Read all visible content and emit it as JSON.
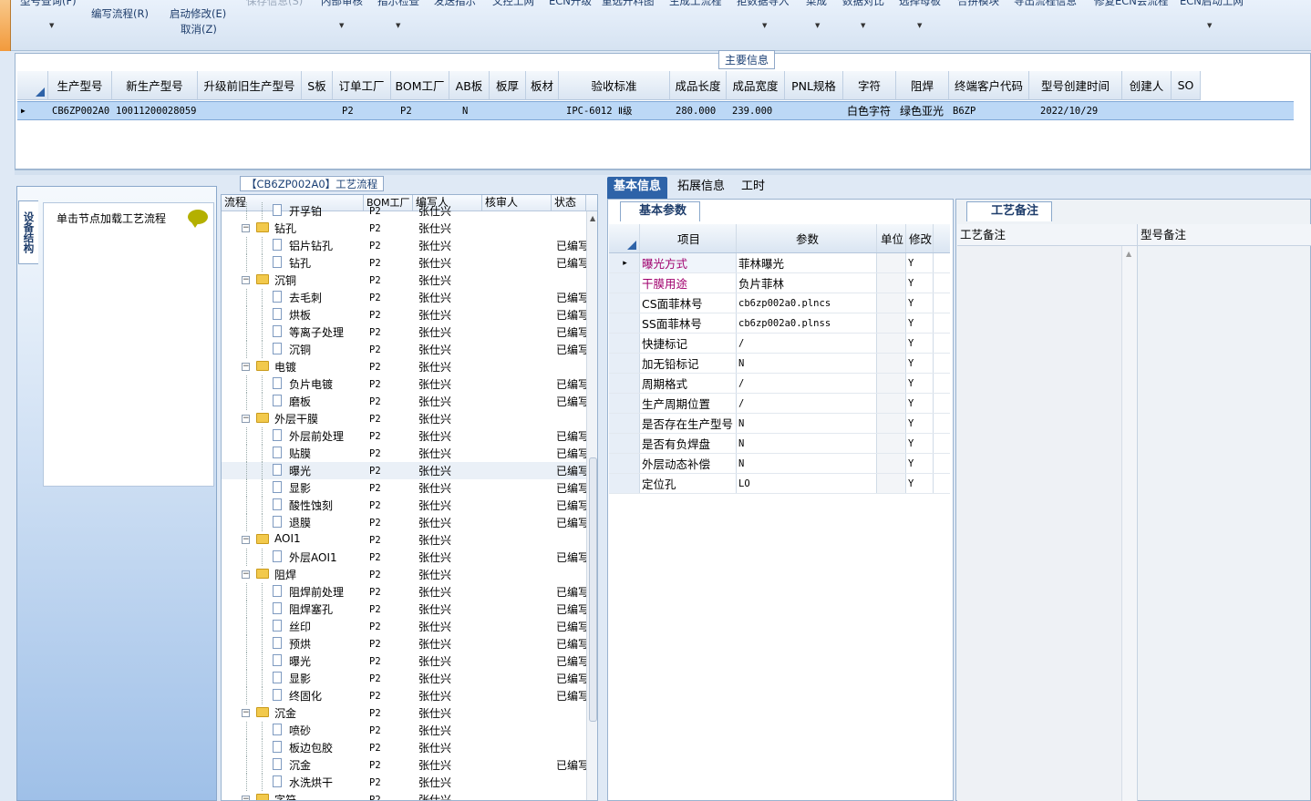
{
  "toolbar": {
    "items": [
      "型号查询(F)",
      "编写流程(R)",
      "启动修改(E)",
      "保存信息(S)",
      "内部审核",
      "指示检查",
      "发送指示",
      "文控上网",
      "ECN升级",
      "重选开料图",
      "生成工流程",
      "拒数据导入",
      "菜成",
      "数据对比",
      "选择母板",
      "合拼模块",
      "导出流程信息",
      "修复ECN会流程",
      "ECN启动上网"
    ],
    "sub_cancel": "取消(Z)"
  },
  "main_info": {
    "caption": "主要信息",
    "columns": [
      "生产型号",
      "新生产型号",
      "升级前旧生产型号",
      "S板",
      "订单工厂",
      "BOM工厂",
      "AB板",
      "板厚",
      "板材",
      "验收标准",
      "成品长度",
      "成品宽度",
      "PNL规格",
      "字符",
      "阻焊",
      "终端客户代码",
      "型号创建时间",
      "创建人",
      "SO"
    ],
    "row": [
      "CB6ZP002A0",
      "10011200028059",
      "",
      "",
      "P2",
      "P2",
      "N",
      "",
      "",
      "IPC-6012 Ⅱ级",
      "280.000",
      "239.000",
      "",
      "白色字符",
      "绿色亚光",
      "B6ZP",
      "2022/10/29",
      "",
      ""
    ]
  },
  "left_panel": {
    "vtab": "设备结构",
    "load_text": "单击节点加载工艺流程"
  },
  "process": {
    "caption": "【CB6ZP002A0】工艺流程",
    "columns": [
      "流程",
      "BOM工厂",
      "编写人",
      "核审人",
      "状态"
    ],
    "rows": [
      {
        "level": 2,
        "type": "doc",
        "name": "开孚铂",
        "bom": "P2",
        "writer": "张仕兴",
        "status": ""
      },
      {
        "level": 1,
        "type": "folder",
        "name": "钻孔",
        "bom": "P2",
        "writer": "张仕兴",
        "status": ""
      },
      {
        "level": 2,
        "type": "doc",
        "name": "铝片钻孔",
        "bom": "P2",
        "writer": "张仕兴",
        "status": "已编写"
      },
      {
        "level": 2,
        "type": "doc",
        "name": "钻孔",
        "bom": "P2",
        "writer": "张仕兴",
        "status": "已编写"
      },
      {
        "level": 1,
        "type": "folder",
        "name": "沉铜",
        "bom": "P2",
        "writer": "张仕兴",
        "status": ""
      },
      {
        "level": 2,
        "type": "doc",
        "name": "去毛刺",
        "bom": "P2",
        "writer": "张仕兴",
        "status": "已编写"
      },
      {
        "level": 2,
        "type": "doc",
        "name": "烘板",
        "bom": "P2",
        "writer": "张仕兴",
        "status": "已编写"
      },
      {
        "level": 2,
        "type": "doc",
        "name": "等离子处理",
        "bom": "P2",
        "writer": "张仕兴",
        "status": "已编写"
      },
      {
        "level": 2,
        "type": "doc",
        "name": "沉铜",
        "bom": "P2",
        "writer": "张仕兴",
        "status": "已编写"
      },
      {
        "level": 1,
        "type": "folder",
        "name": "电镀",
        "bom": "P2",
        "writer": "张仕兴",
        "status": ""
      },
      {
        "level": 2,
        "type": "doc",
        "name": "负片电镀",
        "bom": "P2",
        "writer": "张仕兴",
        "status": "已编写"
      },
      {
        "level": 2,
        "type": "doc",
        "name": "磨板",
        "bom": "P2",
        "writer": "张仕兴",
        "status": "已编写"
      },
      {
        "level": 1,
        "type": "folder",
        "name": "外层干膜",
        "bom": "P2",
        "writer": "张仕兴",
        "status": ""
      },
      {
        "level": 2,
        "type": "doc",
        "name": "外层前处理",
        "bom": "P2",
        "writer": "张仕兴",
        "status": "已编写"
      },
      {
        "level": 2,
        "type": "doc",
        "name": "贴膜",
        "bom": "P2",
        "writer": "张仕兴",
        "status": "已编写"
      },
      {
        "level": 2,
        "type": "doc",
        "name": "曝光",
        "bom": "P2",
        "writer": "张仕兴",
        "status": "已编写",
        "selected": true
      },
      {
        "level": 2,
        "type": "doc",
        "name": "显影",
        "bom": "P2",
        "writer": "张仕兴",
        "status": "已编写"
      },
      {
        "level": 2,
        "type": "doc",
        "name": "酸性蚀刻",
        "bom": "P2",
        "writer": "张仕兴",
        "status": "已编写"
      },
      {
        "level": 2,
        "type": "doc",
        "name": "退膜",
        "bom": "P2",
        "writer": "张仕兴",
        "status": "已编写"
      },
      {
        "level": 1,
        "type": "folder",
        "name": "AOI1",
        "bom": "P2",
        "writer": "张仕兴",
        "status": ""
      },
      {
        "level": 2,
        "type": "doc",
        "name": "外层AOI1",
        "bom": "P2",
        "writer": "张仕兴",
        "status": "已编写"
      },
      {
        "level": 1,
        "type": "folder",
        "name": "阻焊",
        "bom": "P2",
        "writer": "张仕兴",
        "status": ""
      },
      {
        "level": 2,
        "type": "doc",
        "name": "阻焊前处理",
        "bom": "P2",
        "writer": "张仕兴",
        "status": "已编写"
      },
      {
        "level": 2,
        "type": "doc",
        "name": "阻焊塞孔",
        "bom": "P2",
        "writer": "张仕兴",
        "status": "已编写"
      },
      {
        "level": 2,
        "type": "doc",
        "name": "丝印",
        "bom": "P2",
        "writer": "张仕兴",
        "status": "已编写"
      },
      {
        "level": 2,
        "type": "doc",
        "name": "预烘",
        "bom": "P2",
        "writer": "张仕兴",
        "status": "已编写"
      },
      {
        "level": 2,
        "type": "doc",
        "name": "曝光",
        "bom": "P2",
        "writer": "张仕兴",
        "status": "已编写"
      },
      {
        "level": 2,
        "type": "doc",
        "name": "显影",
        "bom": "P2",
        "writer": "张仕兴",
        "status": "已编写"
      },
      {
        "level": 2,
        "type": "doc",
        "name": "终固化",
        "bom": "P2",
        "writer": "张仕兴",
        "status": "已编写"
      },
      {
        "level": 1,
        "type": "folder",
        "name": "沉金",
        "bom": "P2",
        "writer": "张仕兴",
        "status": ""
      },
      {
        "level": 2,
        "type": "doc",
        "name": "喷砂",
        "bom": "P2",
        "writer": "张仕兴",
        "status": ""
      },
      {
        "level": 2,
        "type": "doc",
        "name": "板边包胶",
        "bom": "P2",
        "writer": "张仕兴",
        "status": ""
      },
      {
        "level": 2,
        "type": "doc",
        "name": "沉金",
        "bom": "P2",
        "writer": "张仕兴",
        "status": "已编写"
      },
      {
        "level": 2,
        "type": "doc",
        "name": "水洗烘干",
        "bom": "P2",
        "writer": "张仕兴",
        "status": ""
      },
      {
        "level": 1,
        "type": "folder",
        "name": "字符",
        "bom": "P2",
        "writer": "张仕兴",
        "status": ""
      }
    ]
  },
  "tabs": [
    "基本信息",
    "拓展信息",
    "工时"
  ],
  "basic_params": {
    "subtab": "基本参数",
    "columns": [
      "项目",
      "参数",
      "单位",
      "修改"
    ],
    "rows": [
      {
        "item": "曝光方式",
        "value": "菲林曝光",
        "unit": "",
        "mod": "Y",
        "highlight": true
      },
      {
        "item": "干膜用途",
        "value": "负片菲林",
        "unit": "",
        "mod": "Y",
        "highlight": true
      },
      {
        "item": "CS面菲林号",
        "value": "cb6zp002a0.plncs",
        "unit": "",
        "mod": "Y"
      },
      {
        "item": "SS面菲林号",
        "value": "cb6zp002a0.plnss",
        "unit": "",
        "mod": "Y"
      },
      {
        "item": "快捷标记",
        "value": "/",
        "unit": "",
        "mod": "Y"
      },
      {
        "item": "加无铅标记",
        "value": "N",
        "unit": "",
        "mod": "Y"
      },
      {
        "item": "周期格式",
        "value": "/",
        "unit": "",
        "mod": "Y"
      },
      {
        "item": "生产周期位置",
        "value": "/",
        "unit": "",
        "mod": "Y"
      },
      {
        "item": "是否存在生产型号",
        "value": "N",
        "unit": "",
        "mod": "Y"
      },
      {
        "item": "是否有负焊盘",
        "value": "N",
        "unit": "",
        "mod": "Y"
      },
      {
        "item": "外层动态补偿",
        "value": "N",
        "unit": "",
        "mod": "Y"
      },
      {
        "item": "定位孔",
        "value": "LO",
        "unit": "",
        "mod": "Y"
      }
    ]
  },
  "remarks": {
    "tab": "工艺备注",
    "columns": [
      "工艺备注",
      "型号备注"
    ]
  },
  "colors": {
    "accent": "#2e63a8",
    "highlight_text": "#a0006e",
    "row_select": "#bcd8f6"
  }
}
